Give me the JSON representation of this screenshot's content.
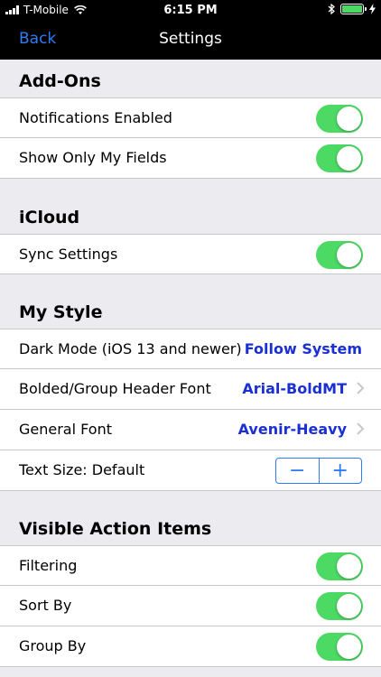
{
  "status_bar": {
    "carrier": "T-Mobile",
    "time": "6:15 PM"
  },
  "nav": {
    "back_label": "Back",
    "title": "Settings"
  },
  "sections": [
    {
      "title": "Add-Ons",
      "rows": [
        {
          "label": "Notifications Enabled",
          "on": true
        },
        {
          "label": "Show Only My Fields",
          "on": true
        }
      ]
    },
    {
      "title": "iCloud",
      "rows": [
        {
          "label": "Sync Settings",
          "on": true
        }
      ]
    },
    {
      "title": "My Style",
      "rows": [
        {
          "label": "Dark Mode (iOS 13 and newer)",
          "value": "Follow System"
        },
        {
          "label": "Bolded/Group Header Font",
          "value": "Arial-BoldMT"
        },
        {
          "label": "General Font",
          "value": "Avenir-Heavy"
        },
        {
          "label": "Text Size: Default",
          "stepper_minus": "−",
          "stepper_plus": "+"
        }
      ]
    },
    {
      "title": "Visible Action Items",
      "rows": [
        {
          "label": "Filtering",
          "on": true
        },
        {
          "label": "Sort By",
          "on": true
        },
        {
          "label": "Group By",
          "on": true
        }
      ]
    }
  ],
  "colors": {
    "accent": "#2f7cf6",
    "toggle_on": "#4cd964",
    "value_text": "#1a2fd4",
    "background": "#ebebf0"
  }
}
